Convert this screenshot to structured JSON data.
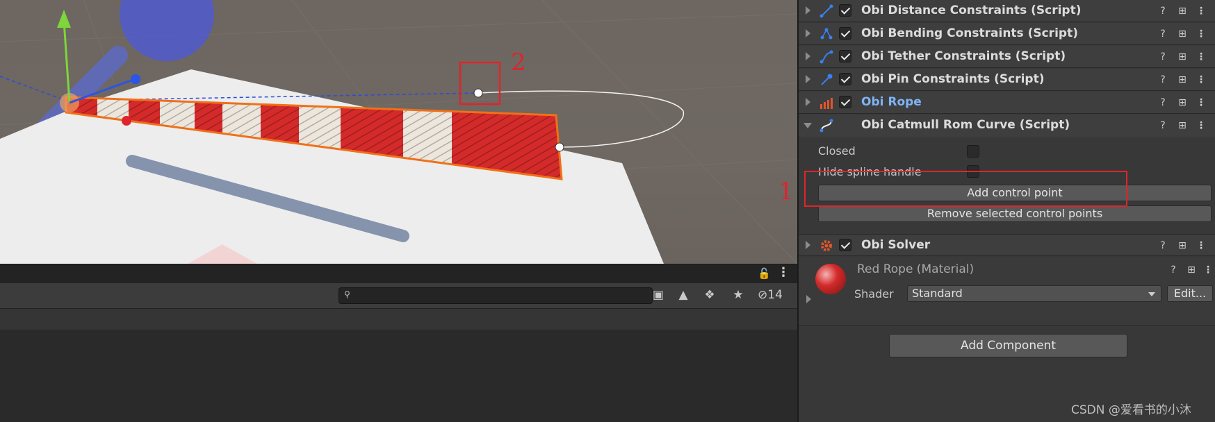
{
  "scene": {
    "annotation_2": "2"
  },
  "inspector": {
    "components": [
      {
        "name": "Obi Distance Constraints (Script)",
        "icon": "distance-icon",
        "enabled": true,
        "highlight": false
      },
      {
        "name": "Obi Bending Constraints (Script)",
        "icon": "bending-icon",
        "enabled": true,
        "highlight": false
      },
      {
        "name": "Obi Tether Constraints (Script)",
        "icon": "tether-icon",
        "enabled": true,
        "highlight": false
      },
      {
        "name": "Obi Pin Constraints (Script)",
        "icon": "pin-icon",
        "enabled": true,
        "highlight": false
      },
      {
        "name": "Obi Rope",
        "icon": "rope-icon",
        "enabled": true,
        "highlight": true
      },
      {
        "name": "Obi Catmull Rom Curve (Script)",
        "icon": "curve-icon",
        "enabled": null,
        "highlight": false
      }
    ],
    "curve_fields": {
      "closed_label": "Closed",
      "hide_handle_label": "Hide spline handle",
      "add_button": "Add control point",
      "remove_button": "Remove selected control points"
    },
    "annotation_1": "1",
    "solver": {
      "name": "Obi Solver"
    },
    "material": {
      "name": "Red Rope (Material)",
      "shader_label": "Shader",
      "shader_value": "Standard",
      "edit_button": "Edit..."
    },
    "add_component": "Add Component"
  },
  "project": {
    "hidden_count": "14"
  },
  "watermark": "CSDN @爱看书的小沐",
  "colors": {
    "accent_red": "#e0242b",
    "link_blue": "#7fb3f5",
    "rope_red": "#d42a2a",
    "selection_orange": "#f07018"
  }
}
